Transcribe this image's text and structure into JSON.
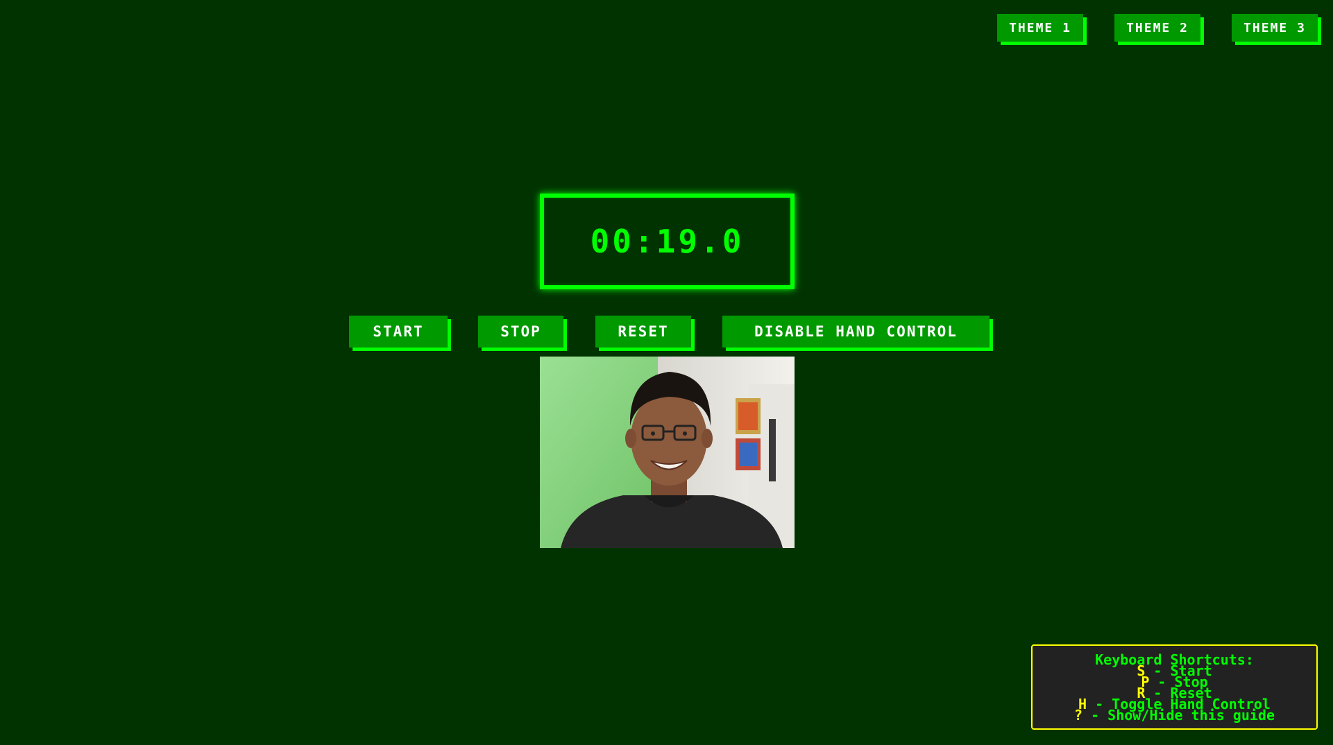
{
  "themes": [
    {
      "label": "THEME 1"
    },
    {
      "label": "THEME 2"
    },
    {
      "label": "THEME 3"
    }
  ],
  "timer": {
    "display": "00:19.0"
  },
  "controls": {
    "start": "START",
    "stop": "STOP",
    "reset": "RESET",
    "hand_control": "DISABLE HAND CONTROL"
  },
  "guide": {
    "title": "Keyboard Shortcuts:",
    "items": [
      {
        "key": "S",
        "text": " - Start"
      },
      {
        "key": "P",
        "text": " - Stop"
      },
      {
        "key": "R",
        "text": " - Reset"
      },
      {
        "key": "H",
        "text": " - Toggle Hand Control"
      },
      {
        "key": "?",
        "text": " - Show/Hide this guide"
      }
    ]
  },
  "colors": {
    "background": "#003300",
    "button": "#009900",
    "accent": "#00ff00",
    "key_highlight": "#ffff00",
    "guide_bg": "#222222"
  }
}
